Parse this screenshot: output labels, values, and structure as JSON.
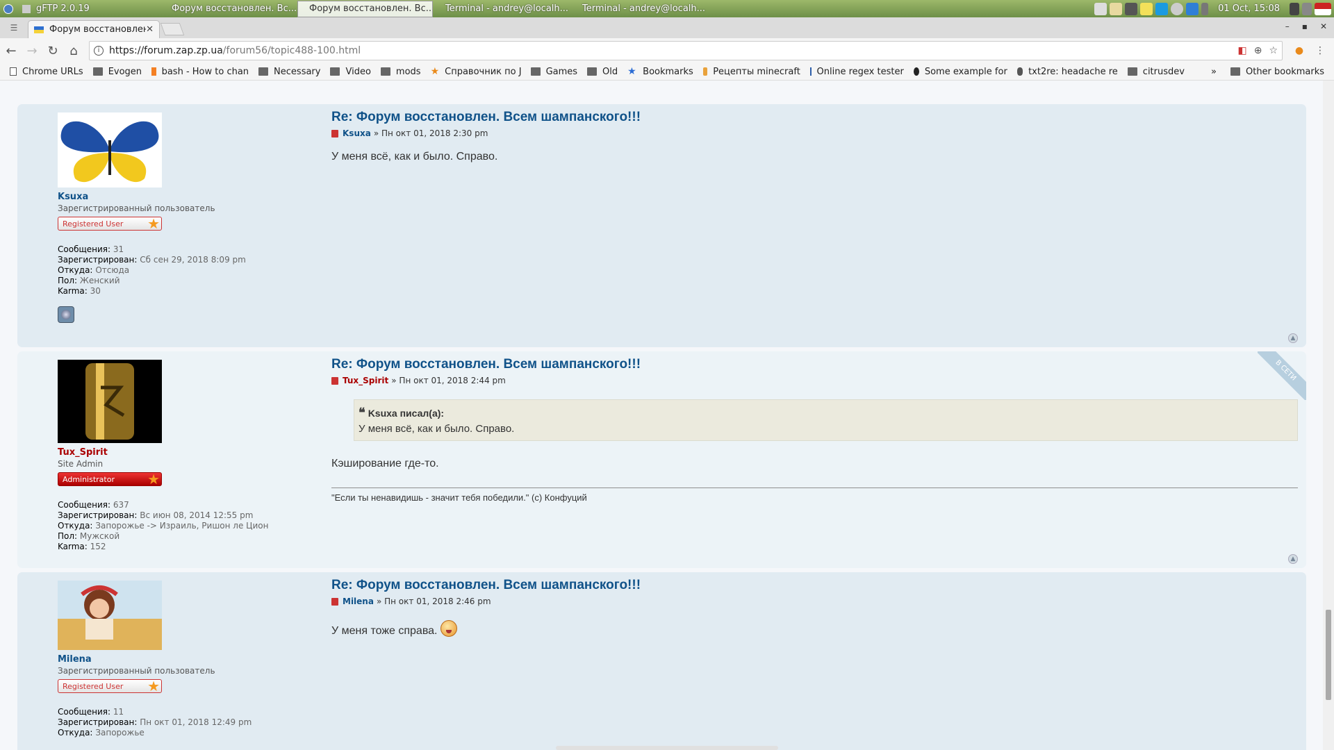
{
  "taskbar": {
    "tasks": [
      {
        "label": "gFTP 2.0.19"
      },
      {
        "label": "Форум восстановлен. Вс..."
      },
      {
        "label": "Форум восстановлен. Вс..."
      },
      {
        "label": "Terminal - andrey@localh..."
      },
      {
        "label": "Terminal - andrey@localh..."
      }
    ],
    "clock": "01 Oct, 15:08"
  },
  "browser": {
    "tab_title": "Форум восстановлен...",
    "url_host": "https://forum.zap.zp.ua",
    "url_path": "/forum56/topic488-100.html",
    "bookmarks": [
      {
        "label": "Chrome URLs",
        "icon": "page-icon"
      },
      {
        "label": "Evogen",
        "icon": "folder-icon"
      },
      {
        "label": "bash - How to chan",
        "icon": "stackoverflow-icon"
      },
      {
        "label": "Necessary",
        "icon": "folder-icon"
      },
      {
        "label": "Video",
        "icon": "folder-icon"
      },
      {
        "label": "mods",
        "icon": "folder-icon"
      },
      {
        "label": "Справочник по Jav",
        "icon": "star-icon"
      },
      {
        "label": "Games",
        "icon": "folder-icon"
      },
      {
        "label": "Old",
        "icon": "folder-icon"
      },
      {
        "label": "Bookmarks",
        "icon": "blue-star-icon"
      },
      {
        "label": "Рецепты minecraft",
        "icon": "minecraft-icon"
      },
      {
        "label": "Online regex tester",
        "icon": "regex-icon"
      },
      {
        "label": "Some example for",
        "icon": "github-icon"
      },
      {
        "label": "txt2re: headache re",
        "icon": "txt2re-icon"
      },
      {
        "label": "citrusdev",
        "icon": "folder-icon"
      }
    ],
    "more": "»",
    "other_bookmarks": "Other bookmarks"
  },
  "posts": [
    {
      "title": "Re: Форум восстановлен. Всем шампанского!!!",
      "author": "Ksuxa",
      "date": "» Пн окт 01, 2018 2:30 pm",
      "text": "У меня всё, как и было. Справо.",
      "rank_title": "Зарегистрированный пользователь",
      "rank_badge": "Registered User",
      "stats": {
        "posts_label": "Сообщения:",
        "posts": "31",
        "reg_label": "Зарегистрирован:",
        "reg": "Сб сен 29, 2018 8:09 pm",
        "from_label": "Откуда:",
        "from": "Отсюда",
        "gender_label": "Пол:",
        "gender": "Женский",
        "karma_label": "Karma:",
        "karma": "30"
      }
    },
    {
      "title": "Re: Форум восстановлен. Всем шампанского!!!",
      "author": "Tux_Spirit",
      "date": "» Пн окт 01, 2018 2:44 pm",
      "quote_header": "Ksuxa писал(а):",
      "quote_text": "У меня всё, как и было. Справо.",
      "text": "Кэширование где-то.",
      "signature": "\"Если ты ненавидишь - значит тебя победили.\" (с) Конфуций",
      "online_label": "В СЕТИ",
      "rank_title": "Site Admin",
      "rank_badge": "Administrator",
      "stats": {
        "posts_label": "Сообщения:",
        "posts": "637",
        "reg_label": "Зарегистрирован:",
        "reg": "Вс июн 08, 2014 12:55 pm",
        "from_label": "Откуда:",
        "from": "Запорожье -> Израиль, Ришон ле Цион",
        "gender_label": "Пол:",
        "gender": "Мужской",
        "karma_label": "Karma:",
        "karma": "152"
      }
    },
    {
      "title": "Re: Форум восстановлен. Всем шампанского!!!",
      "author": "Milena",
      "date": "» Пн окт 01, 2018 2:46 pm",
      "text": "У меня тоже справа.",
      "rank_title": "Зарегистрированный пользователь",
      "rank_badge": "Registered User",
      "stats": {
        "posts_label": "Сообщения:",
        "posts": "11",
        "reg_label": "Зарегистрирован:",
        "reg": "Пн окт 01, 2018 12:49 pm",
        "from_label": "Откуда:",
        "from": "Запорожье"
      }
    }
  ]
}
